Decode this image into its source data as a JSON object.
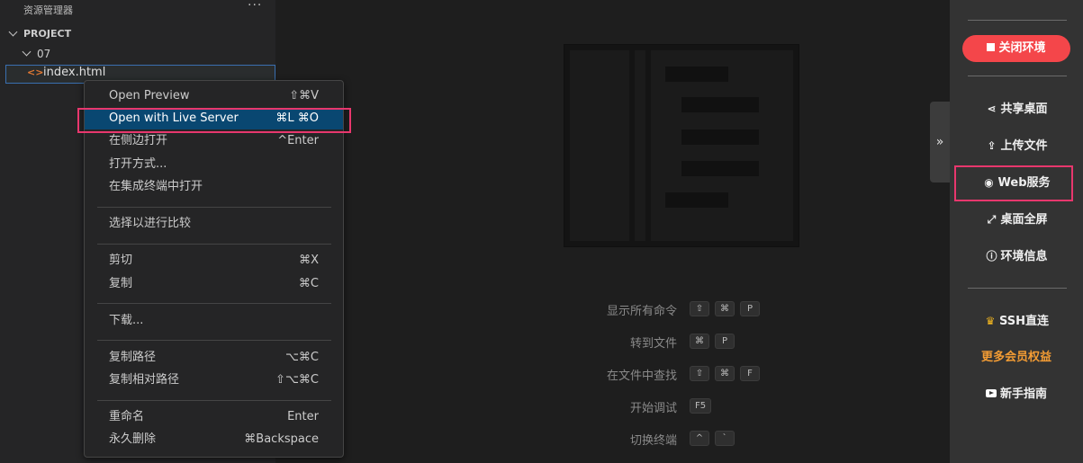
{
  "explorer": {
    "title": "资源管理器",
    "more": "···",
    "project": "PROJECT",
    "folder": "07",
    "file_icon": "<>",
    "file": "index.html"
  },
  "context_menu": {
    "items": [
      {
        "label": "Open Preview",
        "shortcut": "⇧⌘V"
      },
      {
        "label": "Open with Live Server",
        "shortcut": "⌘L ⌘O"
      },
      {
        "label": "在侧边打开",
        "shortcut": "^Enter"
      },
      {
        "label": "打开方式...",
        "shortcut": ""
      },
      {
        "label": "在集成终端中打开",
        "shortcut": ""
      },
      {
        "label": "选择以进行比较",
        "shortcut": ""
      },
      {
        "label": "剪切",
        "shortcut": "⌘X"
      },
      {
        "label": "复制",
        "shortcut": "⌘C"
      },
      {
        "label": "下载...",
        "shortcut": ""
      },
      {
        "label": "复制路径",
        "shortcut": "⌥⌘C"
      },
      {
        "label": "复制相对路径",
        "shortcut": "⇧⌥⌘C"
      },
      {
        "label": "重命名",
        "shortcut": "Enter"
      },
      {
        "label": "永久删除",
        "shortcut": "⌘Backspace"
      }
    ]
  },
  "editor": {
    "commands": [
      {
        "label": "显示所有命令",
        "keys": [
          "⇧",
          "⌘",
          "P"
        ]
      },
      {
        "label": "转到文件",
        "keys": [
          "⌘",
          "P"
        ]
      },
      {
        "label": "在文件中查找",
        "keys": [
          "⇧",
          "⌘",
          "F"
        ]
      },
      {
        "label": "开始调试",
        "keys": [
          "F5"
        ]
      },
      {
        "label": "切换终端",
        "keys": [
          "^",
          "`"
        ]
      }
    ]
  },
  "right_panel": {
    "toggle": "»",
    "close_env": "关闭环境",
    "items": [
      {
        "icon": "share-icon",
        "glyph": "⋖",
        "label": "共享桌面"
      },
      {
        "icon": "upload-icon",
        "glyph": "⇪",
        "label": "上传文件"
      },
      {
        "icon": "globe-icon",
        "glyph": "◉",
        "label": "Web服务"
      },
      {
        "icon": "fullscreen-icon",
        "glyph": "⤢",
        "label": "桌面全屏"
      },
      {
        "icon": "info-icon",
        "glyph": "ⓘ",
        "label": "环境信息"
      }
    ],
    "ssh": {
      "icon": "crown-icon",
      "glyph": "♛",
      "label": "SSH直连"
    },
    "member": "更多会员权益",
    "guide": {
      "icon": "youtube-icon",
      "label": "新手指南"
    },
    "colors": {
      "close_bg": "#f4464a",
      "highlight": "#e8376d",
      "member": "#f39c34"
    }
  }
}
